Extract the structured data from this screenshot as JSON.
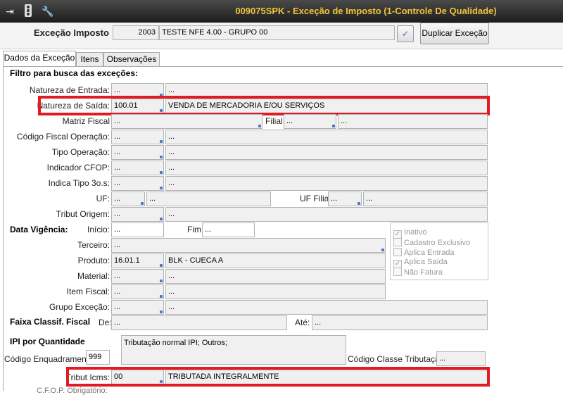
{
  "titlebar": {
    "title": "009075SPK - Exceção de Imposto (1-Controle De Qualidade)"
  },
  "header": {
    "label": "Exceção Imposto",
    "code": "2003",
    "description": "TESTE NFE 4.00 - GRUPO 00",
    "confirm_glyph": "✓",
    "duplicate_label": "Duplicar Exceção"
  },
  "tabs": [
    "Dados da Exceção",
    "Itens",
    "Observações"
  ],
  "filter": {
    "section_title": "Filtro para busca das exceções:",
    "natureza_entrada": {
      "label": "Natureza de Entrada:",
      "code": "...",
      "desc": "..."
    },
    "natureza_saida": {
      "label": "Natureza de Saída:",
      "code": "100.01",
      "desc": "VENDA DE MERCADORIA E/OU SERVIÇOS"
    },
    "matriz_fiscal": {
      "label": "Matriz Fiscal",
      "code": "..."
    },
    "filial": {
      "label": "Filial:",
      "code": "...",
      "desc": "..."
    },
    "cfo": {
      "label": "Código Fiscal Operação:",
      "code": "...",
      "desc": "..."
    },
    "tipo_operacao": {
      "label": "Tipo Operação:",
      "code": "...",
      "desc": "..."
    },
    "indicador_cfop": {
      "label": "Indicador CFOP:",
      "code": "...",
      "desc": "..."
    },
    "indica_tipo": {
      "label": "Indica Tipo 3o.s:",
      "code": "...",
      "desc": "..."
    },
    "uf": {
      "label": "UF:",
      "code": "...",
      "desc": "..."
    },
    "uf_filial": {
      "label": "UF Filial",
      "code": "...",
      "desc": "..."
    },
    "tributo_origem": {
      "label": "Tribut Origem:",
      "code": "...",
      "desc": "..."
    }
  },
  "vigencia": {
    "section": "Data Vigência:",
    "inicio_label": "Início:",
    "inicio": "...",
    "fim_label": "Fim",
    "fim": "..."
  },
  "terceiro": {
    "label": "Terceiro:",
    "code": "..."
  },
  "produto": {
    "label": "Produto:",
    "code": "16.01.1",
    "desc": "BLK - CUECA A"
  },
  "material": {
    "label": "Material:",
    "code": "...",
    "desc": "..."
  },
  "item_fiscal": {
    "label": "Item Fiscal:",
    "code": "...",
    "desc": "..."
  },
  "grupo_excecao": {
    "label": "Grupo Exceção:",
    "code": "...",
    "desc": "..."
  },
  "checkboxes": [
    {
      "label": "Inativo",
      "checked": true
    },
    {
      "label": "Cadastro Exclusivo",
      "checked": false
    },
    {
      "label": "Aplica Entrada",
      "checked": false
    },
    {
      "label": "Aplica Saída",
      "checked": true
    },
    {
      "label": "Não Fatura",
      "checked": false
    }
  ],
  "faixa": {
    "section": "Faixa Classif. Fiscal",
    "de_label": "De:",
    "de": "...",
    "ate_label": "Até:",
    "ate": "..."
  },
  "ipi": {
    "section": "IPI por Quantidade",
    "enquadramento_label": "Código Enquadramento",
    "enquadramento": "999",
    "tributacao_text": "Tributação normal IPI; Outros;",
    "classe_label": "Código Classe Tributação",
    "classe": "..."
  },
  "tributo_icms": {
    "label": "Tribut Icms:",
    "code": "00",
    "desc": "TRIBUTADA INTEGRALMENTE"
  },
  "cfop_obrig": {
    "label": "C.F.O.P. Obrigatório:"
  },
  "colors": {
    "title": "#f0c43a",
    "highlight": "#e21b23",
    "link": "#4a76c9"
  }
}
